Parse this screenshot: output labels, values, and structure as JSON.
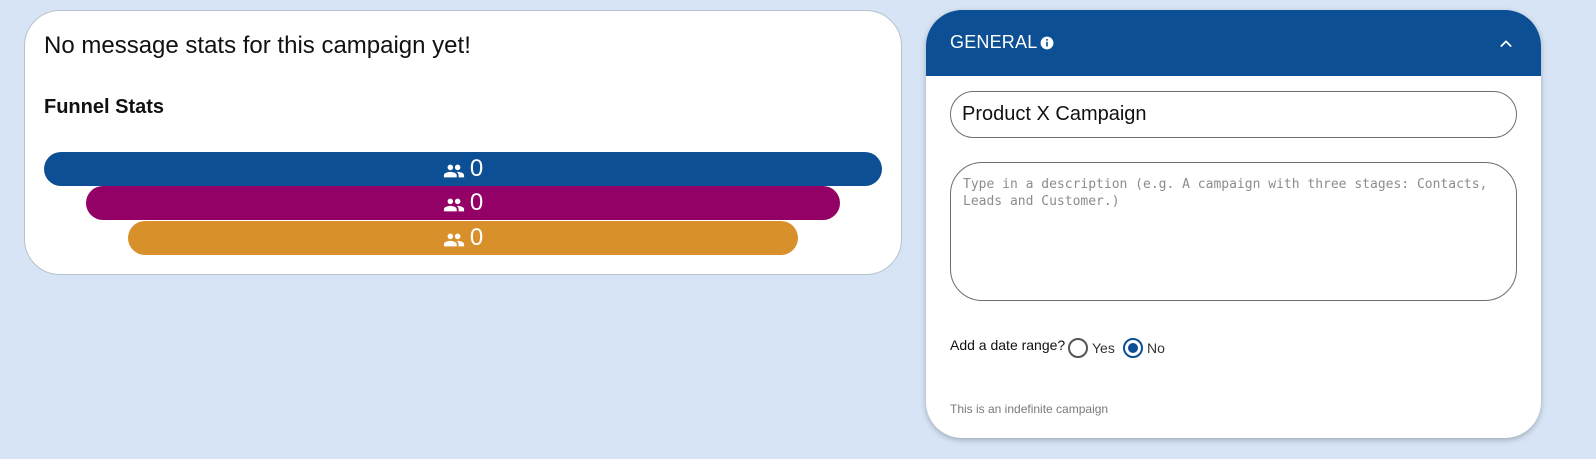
{
  "stats": {
    "empty_message": "No message stats for this campaign yet!",
    "funnel_title": "Funnel Stats",
    "funnel_bars": [
      {
        "count": "0",
        "color": "#0d4f94",
        "icon": "people-icon"
      },
      {
        "count": "0",
        "color": "#930066",
        "icon": "people-icon"
      },
      {
        "count": "0",
        "color": "#d8902a",
        "icon": "people-icon"
      }
    ]
  },
  "general": {
    "title": "GENERAL",
    "header_color": "#0d4f94",
    "info_icon": "info-icon",
    "collapse_icon": "chevron-up-icon",
    "campaign_name": "Product X Campaign",
    "description_placeholder": "Type in a description (e.g. A campaign with three stages: Contacts, Leads and Customer.)",
    "date_range": {
      "label": "Add a date range?",
      "options": [
        {
          "label": "Yes",
          "checked": false
        },
        {
          "label": "No",
          "checked": true
        }
      ]
    },
    "note": "This is an indefinite campaign"
  }
}
